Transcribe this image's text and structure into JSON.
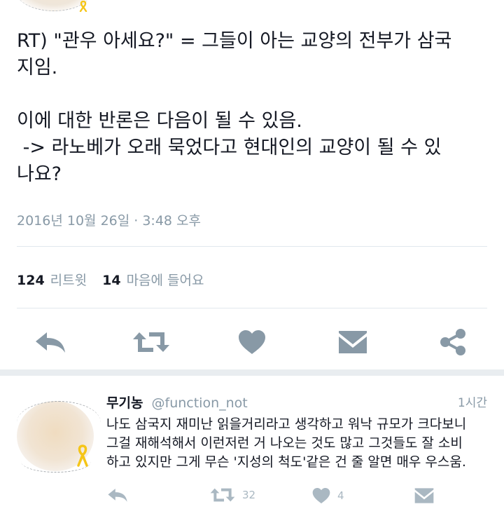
{
  "tweet": {
    "text": "RT) \"관우 아세요?\" = 그들이 아는 교양의 전부가 삼국\n지임.\n\n이에 대한 반론은 다음이 될 수 있음.\n -> 라노베가 오래 묵었다고 현대인의 교양이 될 수 있\n나요?",
    "timestamp": "2016년 10월 26일 · 3:48 오후",
    "retweet_count": "124",
    "retweet_label": "리트윗",
    "like_count": "14",
    "like_label": "마음에 들어요"
  },
  "actions": {
    "icons": [
      "reply-icon",
      "retweet-icon",
      "heart-icon",
      "message-icon",
      "share-icon"
    ]
  },
  "reply": {
    "name": "무기농",
    "handle": "@function_not",
    "time": "1시간",
    "text": "나도 삼국지 재미난 읽을거리라고 생각하고 워낙 규모가 크다보니\n그걸 재해석해서 이런저런 거 나오는 것도 많고 그것들도 잘 소비\n하고 있지만 그게 무슨 '지성의 척도'같은 건 줄 알면 매우 우스움.",
    "retweet_count": "32",
    "like_count": "4"
  },
  "colors": {
    "text": "#141823",
    "muted": "#8899a6",
    "divider": "#e1e8ed",
    "separator": "#e9edf0",
    "ribbon": "#f5c518"
  }
}
